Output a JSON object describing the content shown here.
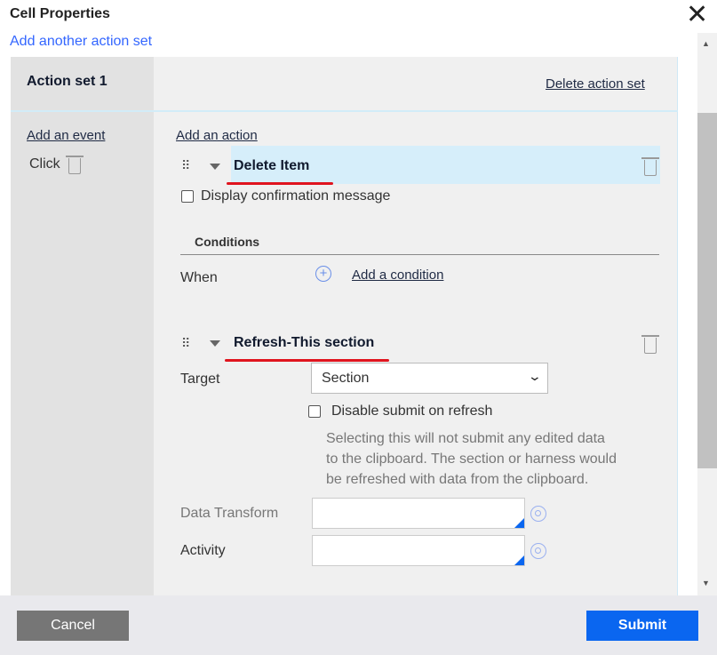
{
  "dialog": {
    "title": "Cell Properties",
    "add_action_set": "Add another action set"
  },
  "action_set": {
    "title": "Action set 1",
    "delete_label": "Delete action set",
    "add_event": "Add an event",
    "event": "Click",
    "add_action": "Add an action"
  },
  "actions": [
    {
      "name": "Delete Item",
      "confirm_label": "Display confirmation message",
      "conditions_heading": "Conditions",
      "when_label": "When",
      "add_condition": "Add a condition"
    },
    {
      "name": "Refresh-This section",
      "target_label": "Target",
      "target_value": "Section",
      "disable_submit_label": "Disable submit on refresh",
      "help_text": [
        "Selecting this will not submit any edited data",
        "to the clipboard. The section or harness would",
        "be refreshed with data from the clipboard."
      ],
      "data_transform_label": "Data Transform",
      "data_transform_value": "",
      "activity_label": "Activity",
      "activity_value": ""
    }
  ],
  "footer": {
    "cancel": "Cancel",
    "submit": "Submit"
  },
  "colors": {
    "link": "#3366ff",
    "primary": "#0a66f0",
    "highlight": "#d6eefa",
    "annotation": "#e0141e"
  }
}
